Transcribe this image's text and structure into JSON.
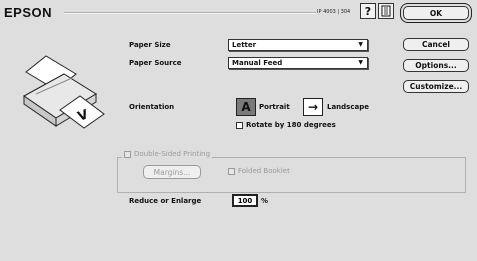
{
  "header": {
    "brand": "EPSON",
    "version": "IP 4003 | 304",
    "help_icon": "?",
    "info_icon": "book-icon"
  },
  "buttons": {
    "ok": "OK",
    "cancel": "Cancel",
    "options": "Options...",
    "customize": "Customize..."
  },
  "paper": {
    "size_label": "Paper Size",
    "size_value": "Letter",
    "source_label": "Paper Source",
    "source_value": "Manual Feed"
  },
  "orientation": {
    "label": "Orientation",
    "portrait_label": "Portrait",
    "landscape_label": "Landscape",
    "portrait_icon": "A",
    "landscape_icon": "→",
    "rotate_label": "Rotate by 180 degrees",
    "selected": "Portrait"
  },
  "duplex": {
    "title": "Double-Sided Printing",
    "margins_button": "Margins...",
    "folded_label": "Folded Booklet",
    "enabled": false
  },
  "scale": {
    "label": "Reduce or Enlarge",
    "value": "100",
    "unit": "%"
  }
}
